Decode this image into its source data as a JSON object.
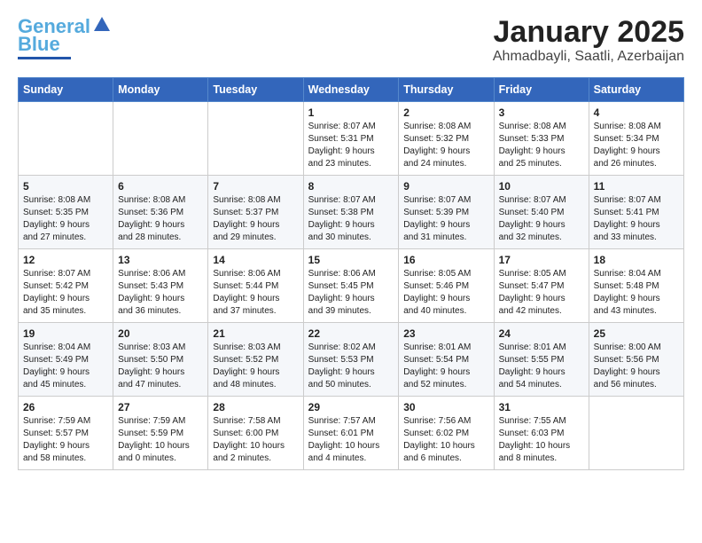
{
  "logo": {
    "line1": "General",
    "line2": "Blue"
  },
  "title": "January 2025",
  "subtitle": "Ahmadbayli, Saatli, Azerbaijan",
  "weekdays": [
    "Sunday",
    "Monday",
    "Tuesday",
    "Wednesday",
    "Thursday",
    "Friday",
    "Saturday"
  ],
  "weeks": [
    [
      {
        "day": "",
        "info": ""
      },
      {
        "day": "",
        "info": ""
      },
      {
        "day": "",
        "info": ""
      },
      {
        "day": "1",
        "info": "Sunrise: 8:07 AM\nSunset: 5:31 PM\nDaylight: 9 hours\nand 23 minutes."
      },
      {
        "day": "2",
        "info": "Sunrise: 8:08 AM\nSunset: 5:32 PM\nDaylight: 9 hours\nand 24 minutes."
      },
      {
        "day": "3",
        "info": "Sunrise: 8:08 AM\nSunset: 5:33 PM\nDaylight: 9 hours\nand 25 minutes."
      },
      {
        "day": "4",
        "info": "Sunrise: 8:08 AM\nSunset: 5:34 PM\nDaylight: 9 hours\nand 26 minutes."
      }
    ],
    [
      {
        "day": "5",
        "info": "Sunrise: 8:08 AM\nSunset: 5:35 PM\nDaylight: 9 hours\nand 27 minutes."
      },
      {
        "day": "6",
        "info": "Sunrise: 8:08 AM\nSunset: 5:36 PM\nDaylight: 9 hours\nand 28 minutes."
      },
      {
        "day": "7",
        "info": "Sunrise: 8:08 AM\nSunset: 5:37 PM\nDaylight: 9 hours\nand 29 minutes."
      },
      {
        "day": "8",
        "info": "Sunrise: 8:07 AM\nSunset: 5:38 PM\nDaylight: 9 hours\nand 30 minutes."
      },
      {
        "day": "9",
        "info": "Sunrise: 8:07 AM\nSunset: 5:39 PM\nDaylight: 9 hours\nand 31 minutes."
      },
      {
        "day": "10",
        "info": "Sunrise: 8:07 AM\nSunset: 5:40 PM\nDaylight: 9 hours\nand 32 minutes."
      },
      {
        "day": "11",
        "info": "Sunrise: 8:07 AM\nSunset: 5:41 PM\nDaylight: 9 hours\nand 33 minutes."
      }
    ],
    [
      {
        "day": "12",
        "info": "Sunrise: 8:07 AM\nSunset: 5:42 PM\nDaylight: 9 hours\nand 35 minutes."
      },
      {
        "day": "13",
        "info": "Sunrise: 8:06 AM\nSunset: 5:43 PM\nDaylight: 9 hours\nand 36 minutes."
      },
      {
        "day": "14",
        "info": "Sunrise: 8:06 AM\nSunset: 5:44 PM\nDaylight: 9 hours\nand 37 minutes."
      },
      {
        "day": "15",
        "info": "Sunrise: 8:06 AM\nSunset: 5:45 PM\nDaylight: 9 hours\nand 39 minutes."
      },
      {
        "day": "16",
        "info": "Sunrise: 8:05 AM\nSunset: 5:46 PM\nDaylight: 9 hours\nand 40 minutes."
      },
      {
        "day": "17",
        "info": "Sunrise: 8:05 AM\nSunset: 5:47 PM\nDaylight: 9 hours\nand 42 minutes."
      },
      {
        "day": "18",
        "info": "Sunrise: 8:04 AM\nSunset: 5:48 PM\nDaylight: 9 hours\nand 43 minutes."
      }
    ],
    [
      {
        "day": "19",
        "info": "Sunrise: 8:04 AM\nSunset: 5:49 PM\nDaylight: 9 hours\nand 45 minutes."
      },
      {
        "day": "20",
        "info": "Sunrise: 8:03 AM\nSunset: 5:50 PM\nDaylight: 9 hours\nand 47 minutes."
      },
      {
        "day": "21",
        "info": "Sunrise: 8:03 AM\nSunset: 5:52 PM\nDaylight: 9 hours\nand 48 minutes."
      },
      {
        "day": "22",
        "info": "Sunrise: 8:02 AM\nSunset: 5:53 PM\nDaylight: 9 hours\nand 50 minutes."
      },
      {
        "day": "23",
        "info": "Sunrise: 8:01 AM\nSunset: 5:54 PM\nDaylight: 9 hours\nand 52 minutes."
      },
      {
        "day": "24",
        "info": "Sunrise: 8:01 AM\nSunset: 5:55 PM\nDaylight: 9 hours\nand 54 minutes."
      },
      {
        "day": "25",
        "info": "Sunrise: 8:00 AM\nSunset: 5:56 PM\nDaylight: 9 hours\nand 56 minutes."
      }
    ],
    [
      {
        "day": "26",
        "info": "Sunrise: 7:59 AM\nSunset: 5:57 PM\nDaylight: 9 hours\nand 58 minutes."
      },
      {
        "day": "27",
        "info": "Sunrise: 7:59 AM\nSunset: 5:59 PM\nDaylight: 10 hours\nand 0 minutes."
      },
      {
        "day": "28",
        "info": "Sunrise: 7:58 AM\nSunset: 6:00 PM\nDaylight: 10 hours\nand 2 minutes."
      },
      {
        "day": "29",
        "info": "Sunrise: 7:57 AM\nSunset: 6:01 PM\nDaylight: 10 hours\nand 4 minutes."
      },
      {
        "day": "30",
        "info": "Sunrise: 7:56 AM\nSunset: 6:02 PM\nDaylight: 10 hours\nand 6 minutes."
      },
      {
        "day": "31",
        "info": "Sunrise: 7:55 AM\nSunset: 6:03 PM\nDaylight: 10 hours\nand 8 minutes."
      },
      {
        "day": "",
        "info": ""
      }
    ]
  ]
}
